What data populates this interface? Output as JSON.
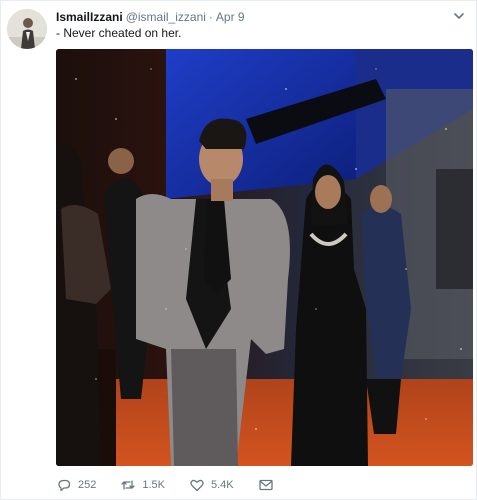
{
  "tweet": {
    "display_name": "IsmailIzzani",
    "handle": "@ismail_izzani",
    "separator": "·",
    "date": "Apr 9",
    "text": "- Never cheated on her.",
    "photo_alt": "Man in grey blazer standing beside a woman in a black hijab on a red carpet",
    "actions": {
      "replies": "252",
      "retweets": "1.5K",
      "likes": "5.4K"
    }
  },
  "icons": {
    "menu": "chevron-down-icon",
    "reply": "reply-icon",
    "retweet": "retweet-icon",
    "like": "heart-icon",
    "dm": "envelope-icon"
  },
  "colors": {
    "text": "#14171a",
    "secondary": "#657786",
    "border": "#e6ecf0",
    "carpet": "#c24a1e"
  }
}
